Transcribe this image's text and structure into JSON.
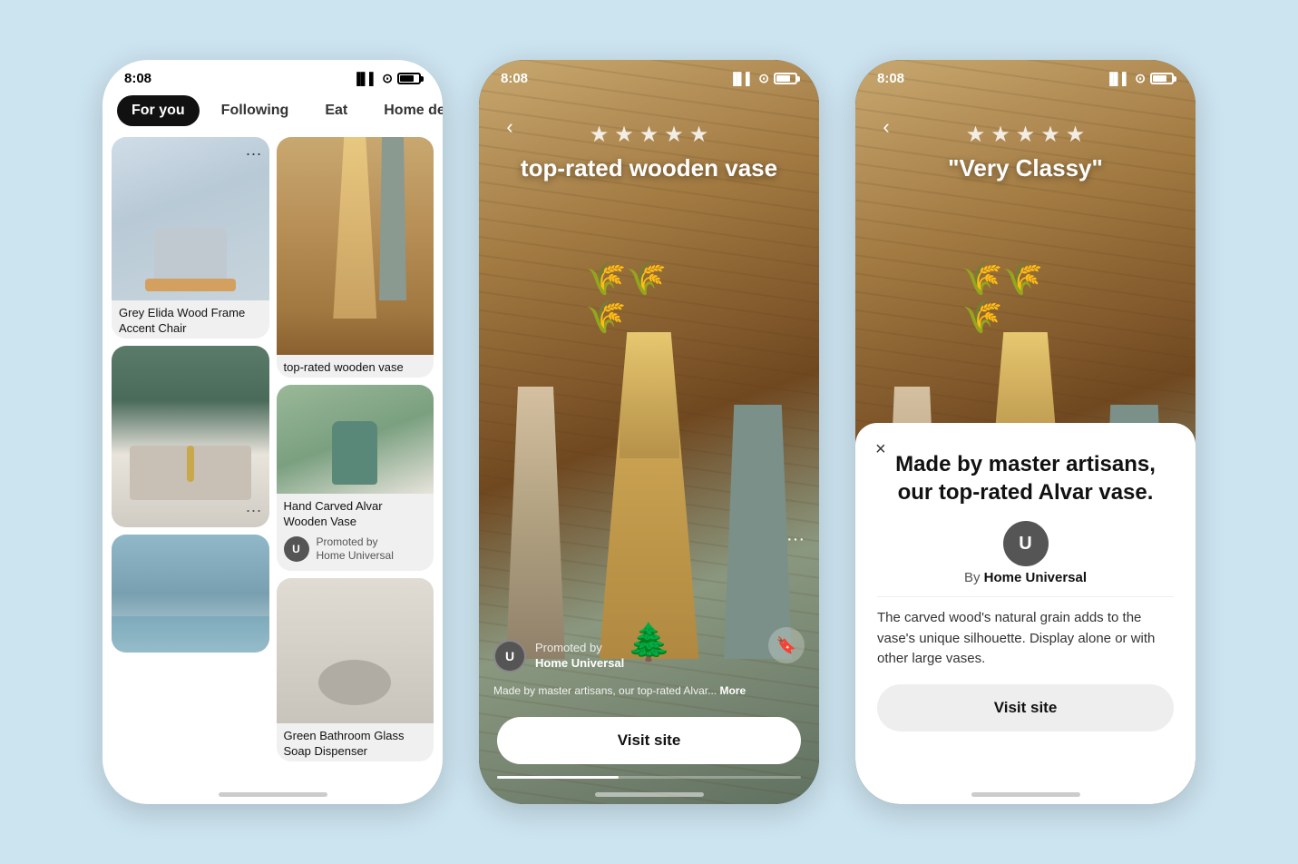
{
  "app": {
    "background_color": "#cce4f0"
  },
  "phone1": {
    "status_time": "8:08",
    "nav": {
      "items": [
        {
          "label": "For you",
          "active": true
        },
        {
          "label": "Following",
          "active": false
        },
        {
          "label": "Eat",
          "active": false
        },
        {
          "label": "Home decor",
          "active": false
        }
      ]
    },
    "cards": [
      {
        "title": "Grey Elida Wood Frame Accent Chair",
        "subtitle": "",
        "col": 0,
        "row": 0,
        "type": "chair"
      },
      {
        "title": "top-rated wooden vase",
        "badge_count": "3",
        "col": 1,
        "row": 0,
        "type": "vase",
        "promoted_by": "Home Universal"
      },
      {
        "title": "Hand Carved Alvar Wooden Vase",
        "col": 1,
        "row": 1,
        "type": "vase2",
        "promoted_by": "Home Universal"
      },
      {
        "title": "",
        "col": 0,
        "row": 1,
        "type": "sink"
      },
      {
        "title": "Green Bathroom Glass Soap Dispenser",
        "col": 1,
        "row": 2,
        "type": "soap"
      },
      {
        "title": "",
        "col": 0,
        "row": 2,
        "type": "bath"
      }
    ]
  },
  "phone2": {
    "status_time": "8:08",
    "stars_count": 5,
    "title": "top-rated wooden vase",
    "promoted_label": "Promoted by",
    "promoted_brand": "Home Universal",
    "description": "Made by master artisans, our top-rated Alvar...",
    "more_label": "More",
    "visit_btn_label": "Visit site",
    "avatar_letter": "U"
  },
  "phone3": {
    "status_time": "8:08",
    "stars_count": 5,
    "title": "\"Very Classy\"",
    "popup": {
      "headline": "Made by master artisans, our top-rated Alvar vase.",
      "by_label": "By",
      "brand": "Home Universal",
      "avatar_letter": "U",
      "description": "The carved wood's natural grain adds to the vase's unique silhouette. Display alone or with other large vases.",
      "visit_btn_label": "Visit site",
      "close_symbol": "×"
    }
  }
}
